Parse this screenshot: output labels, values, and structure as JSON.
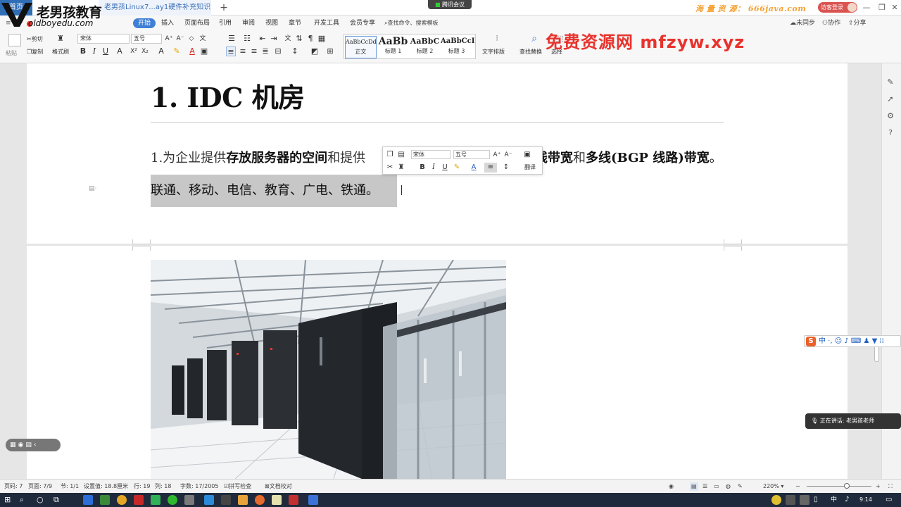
{
  "titlebar": {
    "home_tab": "首页",
    "doc_tab": "老男孩Linux7...ay1硬件补充知识",
    "new_tab": "+",
    "meeting": "腾讯会议",
    "watermark_right": "海 量 资 源： 666java.com",
    "visitor": "访客登录"
  },
  "logo": {
    "title": "老男孩教育",
    "url": "oldboyedu.com"
  },
  "menubar": {
    "items": [
      "开始",
      "插入",
      "页面布局",
      "引用",
      "审阅",
      "视图",
      "章节",
      "开发工具",
      "会员专享"
    ],
    "search_placeholder": "查找命令、搜索模板",
    "right_items": [
      "未同步",
      "协作",
      "分享"
    ]
  },
  "ribbon": {
    "paste": "粘贴",
    "cut": "剪切",
    "copy": "复制",
    "format_painter": "格式刷",
    "font": "宋体",
    "size": "五号",
    "styles": [
      {
        "sample": "AaBbCcDd",
        "name": "正文"
      },
      {
        "sample": "AaBb",
        "name": "标题 1"
      },
      {
        "sample": "AaBbC",
        "name": "标题 2"
      },
      {
        "sample": "AaBbCcI",
        "name": "标题 3"
      }
    ],
    "text_layout": "文字排版",
    "find_replace": "查找替换",
    "select": "选择"
  },
  "watermark_mid": "免费资源网 mfzyw.xyz",
  "document": {
    "heading": "1. IDC 机房",
    "para1_start": "1.为企业提供",
    "para1_b1": "存放服务器的空间",
    "para1_mid": "和提供",
    "para1_end_b1": "线带宽",
    "para1_end_mid": "和",
    "para1_end_b2": "多线(BGP 线路)带宽",
    "para1_end_dot": "。",
    "para2": "联通、移动、电信、教育、广电、铁通。"
  },
  "minibar": {
    "font": "宋体",
    "size": "五号",
    "translate": "翻译"
  },
  "ime": {
    "logo": "S",
    "text": "中 ·, ☺ ♪ ⌨ ♟ ▼ ⁞⁞"
  },
  "speaker": {
    "text": "正在讲话: 老男孩老师"
  },
  "statusbar": {
    "page_no": "页码: 7",
    "pages": "页面: 7/9",
    "section": "节: 1/1",
    "set_value": "设置值: 18.8厘米",
    "row": "行: 19",
    "col": "列: 18",
    "word_count": "字数: 17/2005",
    "spell_check": "拼写检查",
    "doc_check": "文档校对",
    "zoom": "220%"
  },
  "taskbar": {
    "ime": "中",
    "time": "9:14"
  }
}
